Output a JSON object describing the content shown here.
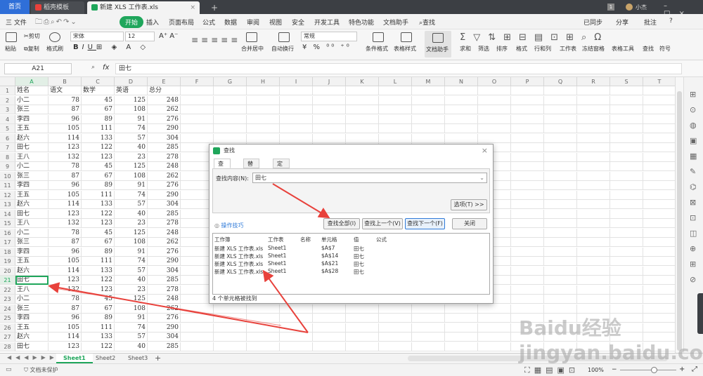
{
  "titlebar": {
    "home_tab": "首页",
    "template_tab": "稻壳模板",
    "file_tab": "新建 XLS 工作表.xls",
    "new_tab": "+",
    "badge": "1",
    "user": "小杰"
  },
  "menu": {
    "file": "三 文件",
    "items": [
      "开始",
      "插入",
      "页面布局",
      "公式",
      "数据",
      "审阅",
      "视图",
      "安全",
      "开发工具",
      "特色功能",
      "文档助手"
    ],
    "search": "查找",
    "right": [
      "已同步",
      "分享",
      "批注",
      "?"
    ]
  },
  "ribbon": {
    "paste": "粘贴",
    "cut": "剪切",
    "copy": "复制",
    "format_painter": "格式刷",
    "font": "宋体",
    "size": "12",
    "merge": "合并居中",
    "wrap": "自动换行",
    "number_format": "常规",
    "cond_format": "条件格式",
    "table_style": "表格样式",
    "doc_helper": "文档助手",
    "sum": "求和",
    "filter": "筛选",
    "sort": "排序",
    "format": "格式",
    "rowcol": "行和列",
    "worksheet": "工作表",
    "freeze": "冻结窗格",
    "table_tools": "表格工具",
    "find": "查找",
    "symbol": "符号"
  },
  "formula": {
    "cell_ref": "A21",
    "fx": "fx",
    "value": "田七"
  },
  "columns": [
    "A",
    "B",
    "C",
    "D",
    "E",
    "F",
    "G",
    "H",
    "I",
    "J",
    "K",
    "L",
    "M",
    "N",
    "O",
    "P",
    "Q",
    "R",
    "S",
    "T"
  ],
  "headers": [
    "姓名",
    "语文",
    "数学",
    "英语",
    "总分"
  ],
  "rows": [
    [
      "小二",
      "78",
      "45",
      "125",
      "248"
    ],
    [
      "张三",
      "87",
      "67",
      "108",
      "262"
    ],
    [
      "李四",
      "96",
      "89",
      "91",
      "276"
    ],
    [
      "王五",
      "105",
      "111",
      "74",
      "290"
    ],
    [
      "赵六",
      "114",
      "133",
      "57",
      "304"
    ],
    [
      "田七",
      "123",
      "122",
      "40",
      "285"
    ],
    [
      "王八",
      "132",
      "123",
      "23",
      "278"
    ],
    [
      "小二",
      "78",
      "45",
      "125",
      "248"
    ],
    [
      "张三",
      "87",
      "67",
      "108",
      "262"
    ],
    [
      "李四",
      "96",
      "89",
      "91",
      "276"
    ],
    [
      "王五",
      "105",
      "111",
      "74",
      "290"
    ],
    [
      "赵六",
      "114",
      "133",
      "57",
      "304"
    ],
    [
      "田七",
      "123",
      "122",
      "40",
      "285"
    ],
    [
      "王八",
      "132",
      "123",
      "23",
      "278"
    ],
    [
      "小二",
      "78",
      "45",
      "125",
      "248"
    ],
    [
      "张三",
      "87",
      "67",
      "108",
      "262"
    ],
    [
      "李四",
      "96",
      "89",
      "91",
      "276"
    ],
    [
      "王五",
      "105",
      "111",
      "74",
      "290"
    ],
    [
      "赵六",
      "114",
      "133",
      "57",
      "304"
    ],
    [
      "田七",
      "123",
      "122",
      "40",
      "285"
    ],
    [
      "王八",
      "132",
      "123",
      "23",
      "278"
    ],
    [
      "小二",
      "78",
      "45",
      "125",
      "248"
    ],
    [
      "张三",
      "87",
      "67",
      "108",
      "262"
    ],
    [
      "李四",
      "96",
      "89",
      "91",
      "276"
    ],
    [
      "王五",
      "105",
      "111",
      "74",
      "290"
    ],
    [
      "赵六",
      "114",
      "133",
      "57",
      "304"
    ],
    [
      "田七",
      "123",
      "122",
      "40",
      "285"
    ]
  ],
  "sheets": [
    "Sheet1",
    "Sheet2",
    "Sheet3"
  ],
  "status": {
    "protect": "文档未保护",
    "zoom": "100%"
  },
  "dialog": {
    "title": "查找",
    "tabs": [
      "查找(D)",
      "替换(P)",
      "定位(G)"
    ],
    "find_label": "查找内容(N):",
    "find_value": "田七",
    "options_btn": "选项(T) >>",
    "tips": "操作技巧",
    "find_all": "查找全部(I)",
    "find_prev": "查找上一个(V)",
    "find_next": "查找下一个(F)",
    "close": "关闭",
    "result_headers": [
      "工作簿",
      "工作表",
      "名称",
      "单元格",
      "值",
      "公式"
    ],
    "results": [
      [
        "新建 XLS 工作表.xls",
        "Sheet1",
        "",
        "$A$7",
        "田七",
        ""
      ],
      [
        "新建 XLS 工作表.xls",
        "Sheet1",
        "",
        "$A$14",
        "田七",
        ""
      ],
      [
        "新建 XLS 工作表.xls",
        "Sheet1",
        "",
        "$A$21",
        "田七",
        ""
      ],
      [
        "新建 XLS 工作表.xls",
        "Sheet1",
        "",
        "$A$28",
        "田七",
        ""
      ]
    ],
    "status": "4 个单元格被找到"
  },
  "watermark": "Baidu经验 jingyan.baidu.com",
  "colors": {
    "accent": "#1fa65b",
    "arrow": "#e8413b"
  }
}
